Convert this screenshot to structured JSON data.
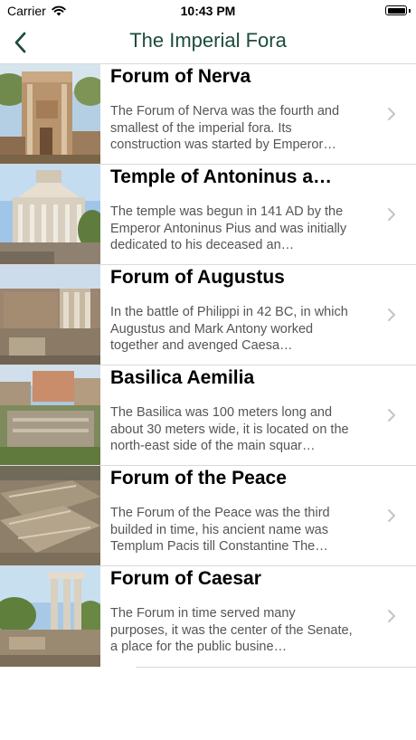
{
  "status_bar": {
    "carrier": "Carrier",
    "time": "10:43 PM"
  },
  "nav": {
    "title": "The Imperial Fora",
    "back_icon": "chevron-left-icon"
  },
  "colors": {
    "accent": "#1c4c3c",
    "separator": "#d9d9d9",
    "description": "#555555"
  },
  "items": [
    {
      "title": "Forum of Nerva",
      "description": "The Forum of Nerva was the fourth and smallest of the imperial fora. Its construction was started by Emperor…"
    },
    {
      "title": "Temple of Antoninus a…",
      "description": "The temple was begun in 141 AD by the Emperor Antoninus Pius and was initially dedicated to his deceased an…"
    },
    {
      "title": "Forum of Augustus",
      "description": "In the battle of Philippi in 42 BC, in which Augustus and Mark Antony worked together and avenged Caesa…"
    },
    {
      "title": "Basilica Aemilia",
      "description": "The Basilica was 100 meters long and about 30 meters wide, it is located on the north-east side of the main squar…"
    },
    {
      "title": "Forum of the Peace",
      "description": "The Forum of the Peace  was the third builded in time, his ancient name was Templum Pacis till Constantine The…"
    },
    {
      "title": "Forum of Caesar",
      "description": "The Forum in time served  many purposes, it was the center of the Senate, a place for the public busine…"
    }
  ]
}
